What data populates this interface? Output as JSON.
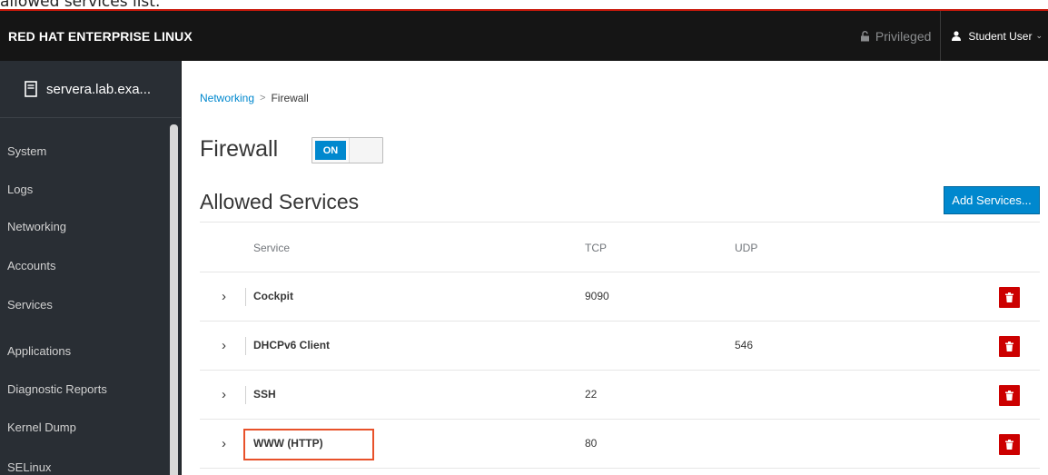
{
  "caption": "allowed services list.",
  "topbar": {
    "brand": "RED HAT ENTERPRISE LINUX",
    "privileged": "Privileged",
    "user": "Student User"
  },
  "sidebar": {
    "host": "servera.lab.exa...",
    "items": [
      {
        "label": "System"
      },
      {
        "label": "Logs"
      },
      {
        "label": "Networking"
      },
      {
        "label": "Accounts"
      },
      {
        "label": "Services"
      },
      {
        "label": "Applications"
      },
      {
        "label": "Diagnostic Reports"
      },
      {
        "label": "Kernel Dump"
      },
      {
        "label": "SELinux"
      }
    ]
  },
  "breadcrumb": {
    "parent": "Networking",
    "separator": ">",
    "current": "Firewall"
  },
  "firewall": {
    "title": "Firewall",
    "toggle_label": "ON",
    "toggle_state": "on"
  },
  "allowed": {
    "title": "Allowed Services",
    "add_button": "Add Services..."
  },
  "table": {
    "headers": {
      "service": "Service",
      "tcp": "TCP",
      "udp": "UDP"
    },
    "rows": [
      {
        "service": "Cockpit",
        "tcp": "9090",
        "udp": ""
      },
      {
        "service": "DHCPv6 Client",
        "tcp": "",
        "udp": "546"
      },
      {
        "service": "SSH",
        "tcp": "22",
        "udp": ""
      },
      {
        "service": "WWW (HTTP)",
        "tcp": "80",
        "udp": "",
        "highlighted": true
      }
    ]
  },
  "colors": {
    "accent": "#0088ce",
    "topbar": "#151515",
    "sidebar": "#292e34",
    "delete": "#cc0000",
    "highlight": "#e8512a"
  },
  "icons": {
    "privileged": "unlock-icon",
    "user": "user-icon",
    "host": "server-icon",
    "expand": "chevron-right-icon",
    "delete": "trash-icon"
  }
}
